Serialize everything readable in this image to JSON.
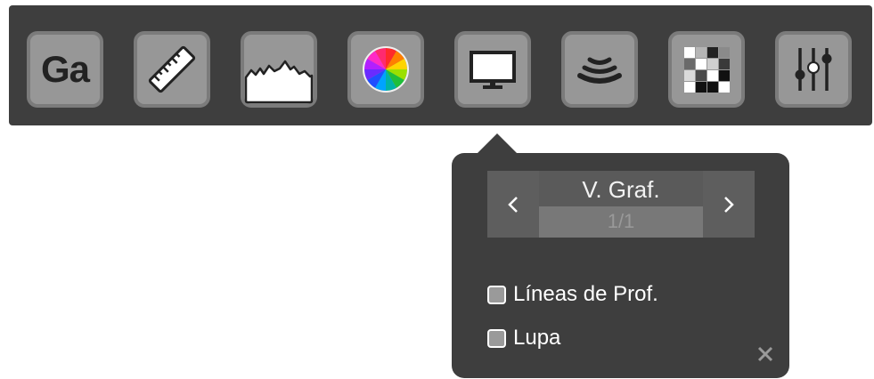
{
  "toolbar": {
    "buttons": [
      {
        "id": "gain",
        "label": "Ga",
        "icon": "gain-text-icon"
      },
      {
        "id": "measure",
        "icon": "ruler-icon"
      },
      {
        "id": "profile",
        "icon": "line-profile-icon"
      },
      {
        "id": "palette",
        "icon": "color-wheel-icon"
      },
      {
        "id": "display",
        "icon": "monitor-icon"
      },
      {
        "id": "sonar",
        "icon": "sonar-waves-icon"
      },
      {
        "id": "grid",
        "icon": "grayscale-grid-icon"
      },
      {
        "id": "settings",
        "icon": "sliders-icon"
      }
    ]
  },
  "popup": {
    "prev_icon": "chevron-left-icon",
    "next_icon": "chevron-right-icon",
    "title": "V. Graf.",
    "page": "1/1",
    "options": [
      {
        "label": "Líneas de Prof.",
        "checked": false
      },
      {
        "label": "Lupa",
        "checked": false
      }
    ],
    "close_icon": "close-icon"
  },
  "colors": {
    "toolbar_bg": "#3e3e3e",
    "button_bg": "#979797",
    "button_border": "#7b7b7b",
    "popup_bg": "#3e3e3e",
    "text": "#ffffff"
  }
}
